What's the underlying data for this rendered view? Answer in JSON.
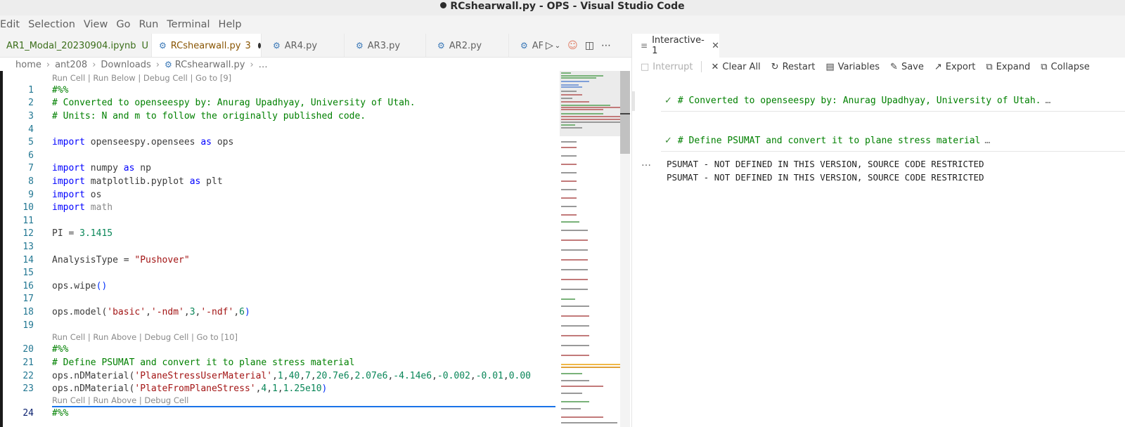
{
  "window": {
    "title": "RCshearwall.py - OPS - Visual Studio Code"
  },
  "menu": [
    "Edit",
    "Selection",
    "View",
    "Go",
    "Run",
    "Terminal",
    "Help"
  ],
  "tabs": [
    {
      "label": "AR1_Modal_20230904.ipynb",
      "badge": "U"
    },
    {
      "label": "RCshearwall.py",
      "badge": "3"
    },
    {
      "label": "AR4.py"
    },
    {
      "label": "AR3.py"
    },
    {
      "label": "AR2.py"
    },
    {
      "label": "AF"
    }
  ],
  "breadcrumb": [
    "home",
    "ant208",
    "Downloads",
    "RCshearwall.py",
    "…"
  ],
  "code_lens": {
    "lens1": "Run Cell | Run Below | Debug Cell | Go to [9]",
    "lens2": "Run Cell | Run Above | Debug Cell | Go to [10]",
    "lens3": "Run Cell | Run Above | Debug Cell"
  },
  "lines": [
    "1",
    "2",
    "3",
    "4",
    "5",
    "6",
    "7",
    "8",
    "9",
    "10",
    "11",
    "12",
    "13",
    "14",
    "15",
    "16",
    "17",
    "18",
    "19",
    "20",
    "21",
    "22",
    "23",
    "24"
  ],
  "code": {
    "l1": "#%%",
    "l2": "# Converted to openseespy by: Anurag Upadhyay, University of Utah.",
    "l3": "# Units: N and m to follow the originally published code.",
    "l5_kw": "import",
    "l5_mod": " openseespy.opensees ",
    "l5_as": "as",
    "l5_alias": " ops",
    "l7_kw": "import",
    "l7_mod": " numpy ",
    "l7_as": "as",
    "l7_alias": " np",
    "l8_kw": "import",
    "l8_mod": " matplotlib.pyplot ",
    "l8_as": "as",
    "l8_alias": " plt",
    "l9_kw": "import",
    "l9_mod": " os",
    "l10_kw": "import",
    "l10_mod": " math",
    "l12_a": "PI = ",
    "l12_b": "3.1415",
    "l14_a": "AnalysisType = ",
    "l14_b": "\"Pushover\"",
    "l16_a": "ops.wipe",
    "l16_b": "()",
    "l18_a": "ops.model(",
    "l18_b": "'basic'",
    "l18_c": ",",
    "l18_d": "'-ndm'",
    "l18_e": ",",
    "l18_f": "3",
    "l18_g": ",",
    "l18_h": "'-ndf'",
    "l18_i": ",",
    "l18_j": "6",
    "l18_k": ")",
    "l20": "#%%",
    "l21": "# Define PSUMAT and convert it to plane stress material",
    "l22_a": "ops.nDMaterial(",
    "l22_b": "'PlaneStressUserMaterial'",
    "l22_c": ",",
    "l22_d": "1",
    "l22_e": ",",
    "l22_f": "40",
    "l22_g": ",",
    "l22_h": "7",
    "l22_i": ",",
    "l22_j": "20.7e6",
    "l22_k": ",",
    "l22_l": "2.07e6",
    "l22_m": ",",
    "l22_n": "-4.14e6",
    "l22_o": ",",
    "l22_p": "-0.002",
    "l22_q": ",",
    "l22_r": "-0.01",
    "l22_s": ",",
    "l22_t": "0.00",
    "l23_a": "ops.nDMaterial(",
    "l23_b": "'PlateFromPlaneStress'",
    "l23_c": ",",
    "l23_d": "4",
    "l23_e": ",",
    "l23_f": "1",
    "l23_g": ",",
    "l23_h": "1.25e10",
    "l23_i": ")",
    "l24": "#%%"
  },
  "interactive": {
    "tab_label": "Interactive-1",
    "toolbar": {
      "interrupt": "Interrupt",
      "clear_all": "Clear All",
      "restart": "Restart",
      "variables": "Variables",
      "save": "Save",
      "export": "Export",
      "expand": "Expand",
      "collapse": "Collapse"
    },
    "cells": [
      {
        "code": "# Converted to openseespy by: Anurag Upadhyay, University of Utah.",
        "more": "…"
      },
      {
        "code": "# Define PSUMAT and convert it to plane stress material",
        "more": "…"
      }
    ],
    "output_more": "…",
    "output": [
      "PSUMAT - NOT DEFINED IN THIS VERSION, SOURCE CODE RESTRICTED",
      "PSUMAT - NOT DEFINED IN THIS VERSION, SOURCE CODE RESTRICTED"
    ]
  },
  "colors": {
    "keyword": "#0000ff",
    "comment": "#008000",
    "string": "#a31515",
    "number": "#098658",
    "accent": "#1a73e8",
    "check": "#388a34"
  }
}
